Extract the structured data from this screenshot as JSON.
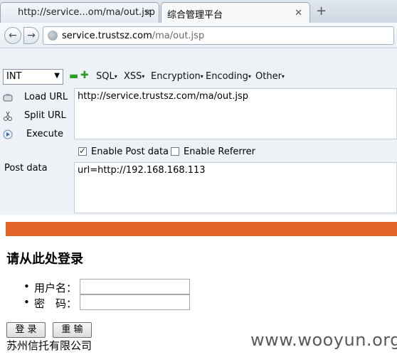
{
  "tabs": [
    {
      "label": "http://service...om/ma/out.jsp",
      "close": "✕"
    },
    {
      "label": "综合管理平台",
      "close": "✕"
    }
  ],
  "new_tab": "+",
  "nav": {
    "back": "←",
    "forward": "→",
    "url_domain": "service.trustsz.com",
    "url_path": "/ma/out.jsp"
  },
  "hackbar": {
    "select_value": "INT",
    "minus": "▬",
    "plus": "✚",
    "menus": [
      "SQL",
      "XSS",
      "Encryption",
      "Encoding",
      "Other"
    ],
    "load_url": "Load URL",
    "split_url": "Split URL",
    "execute": "Execute",
    "url_value": "http://service.trustsz.com/ma/out.jsp",
    "enable_post": "Enable Post data",
    "enable_referrer": "Enable Referrer",
    "post_label": "Post data",
    "post_value": "url=http://192.168.168.113"
  },
  "page": {
    "accent_color": "#e2622a",
    "title": "请从此处登录",
    "bullet": "•",
    "username_label": "用户名：",
    "password_label": "密　码：",
    "login_button": "登 录",
    "reset_button": "重 输",
    "company": "苏州信托有限公司"
  },
  "watermark": "www.wooyun.org"
}
